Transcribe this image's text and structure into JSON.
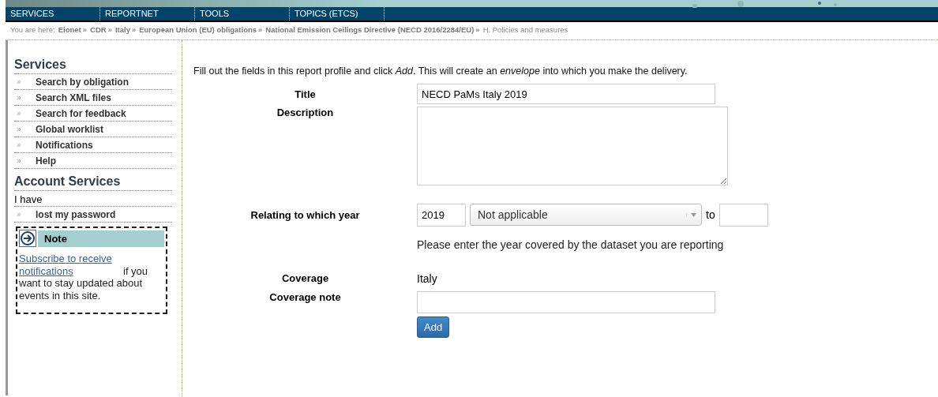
{
  "nav": [
    "SERVICES",
    "REPORTNET",
    "TOOLS",
    "TOPICS (ETCS)"
  ],
  "breadcrumb": {
    "prefix": "You are here:",
    "items": [
      {
        "label": "Eionet",
        "link": true
      },
      {
        "label": "CDR",
        "link": true
      },
      {
        "label": "Italy",
        "link": true
      },
      {
        "label": "European Union (EU) obligations",
        "link": true
      },
      {
        "label": "National Emission Ceilings Directive (NECD 2016/2284/EU)",
        "link": true
      },
      {
        "label": "H. Policies and measures",
        "link": false
      }
    ],
    "separator": "»"
  },
  "sidebar": {
    "services_title": "Services",
    "items": [
      "Search by obligation",
      "Search XML files",
      "Search for feedback",
      "Global worklist",
      "Notifications",
      "Help"
    ],
    "bullet": "»",
    "account_title": "Account Services",
    "account_text": "I have",
    "account_items": [
      "lost my password"
    ],
    "note": {
      "title": "Note",
      "link": "Subscribe to receive notifications ",
      "text": "if you want to stay updated about events in this site."
    }
  },
  "intro": "Fill out the fields in this report profile and click *Add*. This will create an *envelope* into which you make the delivery.",
  "form": {
    "title_label": "Title",
    "title_value": "NECD PaMs Italy 2019",
    "description_label": "Description",
    "year_label": "Relating to which year",
    "year_value": "2019",
    "year_select": "Not applicable",
    "to_label": "to",
    "year_hint": "Please enter the year covered by the dataset you are reporting",
    "coverage_label": "Coverage",
    "coverage_value": "Italy",
    "coverage_note_label": "Coverage note",
    "add_button": "Add"
  }
}
